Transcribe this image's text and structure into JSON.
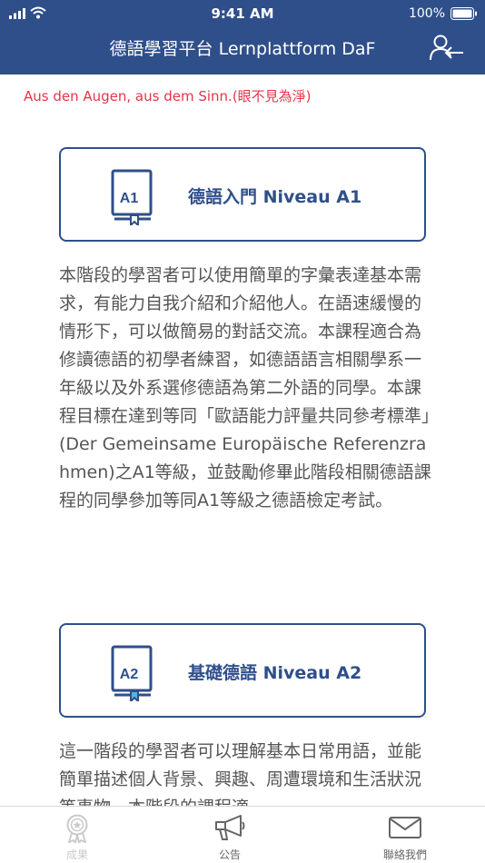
{
  "status": {
    "time": "9:41 AM",
    "battery": "100%"
  },
  "header": {
    "title": "德語學習平台 Lernplattform DaF"
  },
  "proverb": "Aus den Augen, aus dem Sinn.(眼不見為淨)",
  "courses": [
    {
      "level": "A1",
      "title": "德語入門 Niveau A1",
      "description": "本階段的學習者可以使用簡單的字彙表達基本需求，有能力自我介紹和介紹他人。在語速緩慢的情形下，可以做簡易的對話交流。本課程適合為修讀德語的初學者練習，如德語語言相關學系一年級以及外系選修德語為第二外語的同學。本課程目標在達到等同「歐語能力評量共同參考標準」(Der Gemeinsame Europäische Referenzrahmen)之A1等級，並鼓勵修畢此階段相關德語課程的同學參加等同A1等級之德語檢定考試。"
    },
    {
      "level": "A2",
      "title": "基礎德語 Niveau A2",
      "description": "這一階段的學習者可以理解基本日常用語，並能簡單描述個人背景、興趣、周遭環境和生活狀況等事物。本階段的課程適"
    }
  ],
  "tabs": [
    {
      "label": "成果",
      "icon": "medal-icon"
    },
    {
      "label": "公告",
      "icon": "megaphone-icon"
    },
    {
      "label": "聯絡我們",
      "icon": "envelope-icon"
    }
  ],
  "colors": {
    "primary": "#2f4f8a",
    "accent": "#e8334a",
    "ribbon_a2": "#5ab4e0"
  }
}
